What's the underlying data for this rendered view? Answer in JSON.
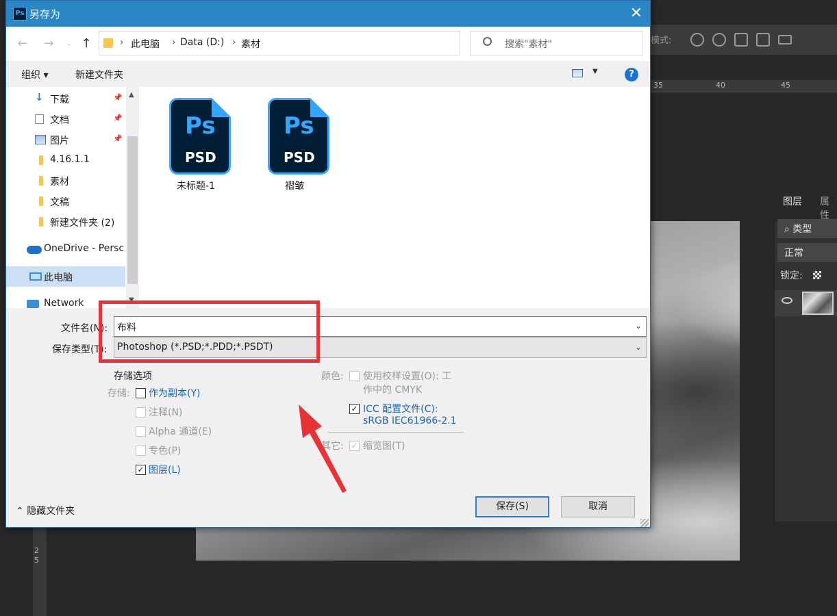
{
  "photoshop": {
    "options_label": "模式:",
    "ruler_ticks": [
      "35",
      "40",
      "45"
    ],
    "left_ruler_ticks": [
      "2",
      "5"
    ],
    "layers_panel": {
      "tabs": [
        "图层",
        "属性"
      ],
      "filter": "类型",
      "blend_mode": "正常",
      "lock_label": "锁定:"
    }
  },
  "dialog": {
    "title": "另存为",
    "address": {
      "crumbs": [
        "此电脑",
        "Data (D:)",
        "素材"
      ]
    },
    "search_placeholder": "搜索\"素材\"",
    "toolbar": {
      "organize": "组织 ▾",
      "new_folder": "新建文件夹"
    },
    "nav_items": [
      {
        "label": "下载",
        "icon": "download-icon",
        "pinned": true
      },
      {
        "label": "文档",
        "icon": "document-icon",
        "pinned": true
      },
      {
        "label": "图片",
        "icon": "picture-icon",
        "pinned": true
      },
      {
        "label": "4.16.1.1",
        "icon": "folder-icon",
        "pinned": false
      },
      {
        "label": "素材",
        "icon": "folder-icon",
        "pinned": false
      },
      {
        "label": "文稿",
        "icon": "folder-icon",
        "pinned": false
      },
      {
        "label": "新建文件夹 (2)",
        "icon": "folder-icon",
        "pinned": false
      },
      {
        "label": "OneDrive - Persc",
        "icon": "onedrive-icon",
        "pinned": false
      },
      {
        "label": "此电脑",
        "icon": "computer-icon",
        "pinned": false,
        "selected": true
      },
      {
        "label": "Network",
        "icon": "network-icon",
        "pinned": false
      }
    ],
    "files": [
      {
        "name": "未标题-1",
        "type_badge": "PSD",
        "icon_text": "Ps"
      },
      {
        "name": "褶皱",
        "type_badge": "PSD",
        "icon_text": "Ps"
      }
    ],
    "filename_label": "文件名(N):",
    "filename_value": "布料",
    "filetype_label": "保存类型(T):",
    "filetype_value": "Photoshop (*.PSD;*.PDD;*.PSDT)",
    "save_options": {
      "heading": "存储选项",
      "save_label": "存储:",
      "as_copy": "作为副本(Y)",
      "notes": "注释(N)",
      "alpha": "Alpha 通道(E)",
      "spot": "专色(P)",
      "layers": "图层(L)",
      "color_label": "颜色:",
      "proof_line1": "使用校样设置(O):  工",
      "proof_line2": "作中的 CMYK",
      "icc_line1": "ICC 配置文件(C):",
      "icc_line2": "sRGB IEC61966-2.1",
      "other_label": "其它:",
      "thumbnail": "缩览图(T)"
    },
    "hide_folders": "隐藏文件夹",
    "save_button": "保存(S)",
    "cancel_button": "取消"
  }
}
